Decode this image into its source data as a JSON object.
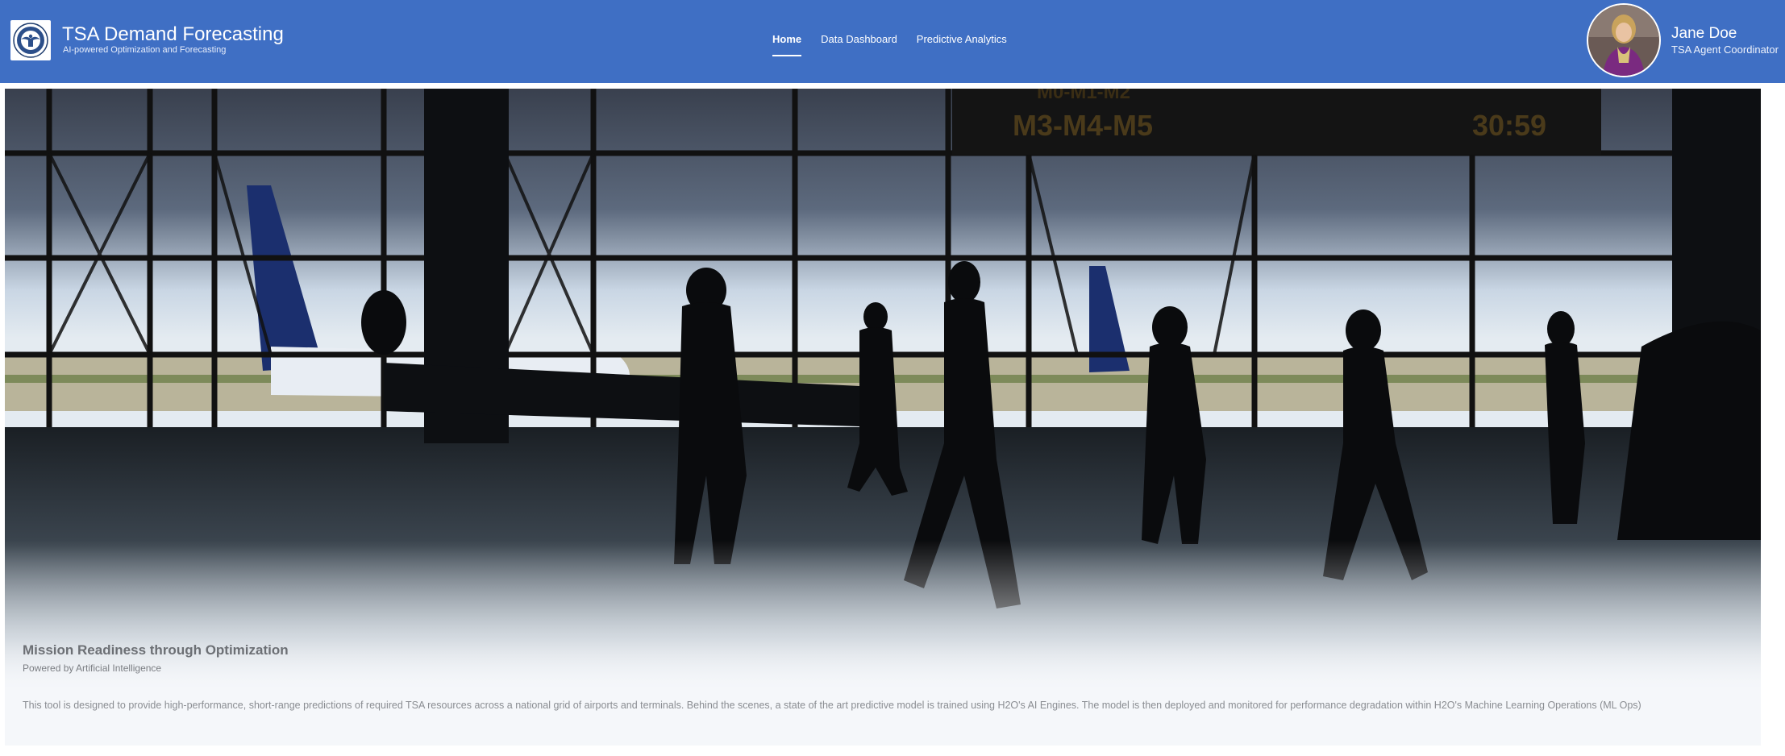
{
  "colors": {
    "accent": "#3f6fc4",
    "hero_background": "#f5f7fa",
    "text_muted": "#8a8d92"
  },
  "header": {
    "logo_icon": "tsa-seal-icon",
    "title": "TSA Demand Forecasting",
    "subtitle": "AI-powered Optimization and Forecasting"
  },
  "nav": {
    "items": [
      {
        "label": "Home",
        "active": true
      },
      {
        "label": "Data Dashboard",
        "active": false
      },
      {
        "label": "Predictive Analytics",
        "active": false
      }
    ]
  },
  "user": {
    "avatar_icon": "user-avatar-icon",
    "name": "Jane Doe",
    "role": "TSA Agent Coordinator"
  },
  "hero": {
    "image_icon": "airport-terminal-photo",
    "sign_top": "M0-M1-M2",
    "sign_bottom": "M3-M4-M5",
    "sign_time": "30:59",
    "title": "Mission Readiness through Optimization",
    "subtitle": "Powered by Artificial Intelligence",
    "description": "This tool is designed to provide high-performance, short-range predictions of required TSA resources across a national grid of airports and terminals. Behind the scenes, a state of the art predictive model is trained using H2O's AI Engines. The model is then deployed and monitored for performance degradation within H2O's Machine Learning Operations (ML Ops)"
  }
}
